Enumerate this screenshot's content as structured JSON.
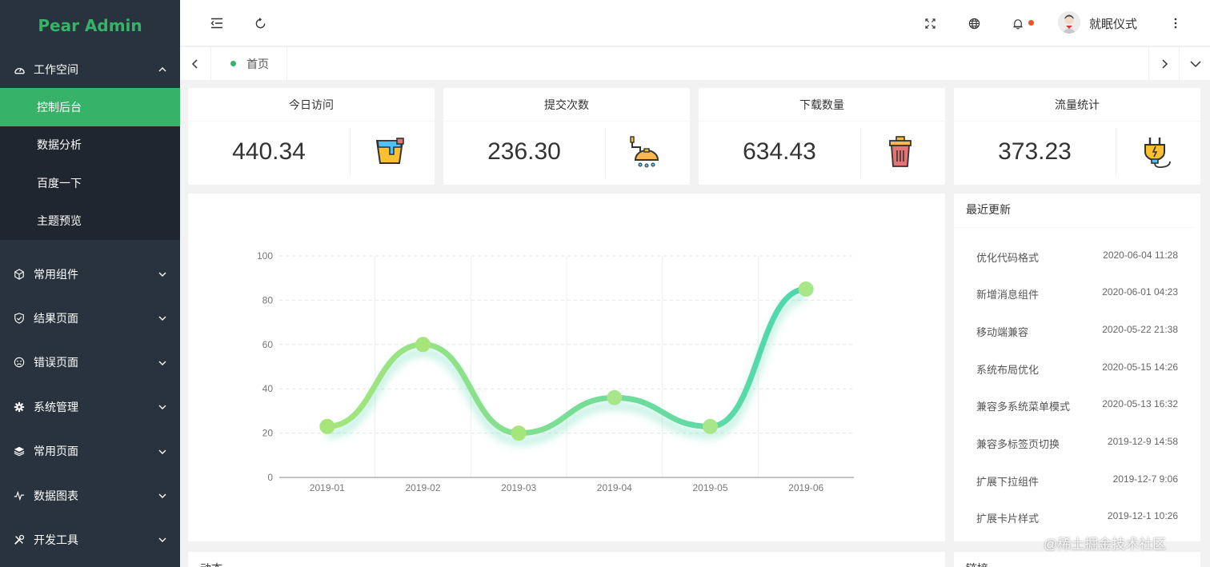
{
  "app": {
    "logo_text": "Pear Admin"
  },
  "sidebar": {
    "groups": [
      {
        "label": "工作空间",
        "icon": "dashboard-icon",
        "expanded": true,
        "items": [
          {
            "label": "控制后台",
            "active": true
          },
          {
            "label": "数据分析"
          },
          {
            "label": "百度一下"
          },
          {
            "label": "主题预览"
          }
        ]
      },
      {
        "label": "常用组件",
        "icon": "cube-icon"
      },
      {
        "label": "结果页面",
        "icon": "shield-check-icon"
      },
      {
        "label": "错误页面",
        "icon": "sad-face-icon"
      },
      {
        "label": "系统管理",
        "icon": "settings-icon"
      },
      {
        "label": "常用页面",
        "icon": "layers-icon"
      },
      {
        "label": "数据图表",
        "icon": "pulse-icon"
      },
      {
        "label": "开发工具",
        "icon": "tools-icon"
      }
    ]
  },
  "header": {
    "username": "就眠仪式",
    "icons": [
      "menu-fold-icon",
      "refresh-icon",
      "fullscreen-icon",
      "globe-icon",
      "bell-icon",
      "more-icon"
    ]
  },
  "tabs": {
    "home_label": "首页"
  },
  "stats": [
    {
      "title": "今日访问",
      "value": "440.34",
      "icon": "paint-bucket-icon"
    },
    {
      "title": "提交次数",
      "value": "236.30",
      "icon": "shower-icon"
    },
    {
      "title": "下载数量",
      "value": "634.43",
      "icon": "trash-bin-icon"
    },
    {
      "title": "流量统计",
      "value": "373.23",
      "icon": "plug-icon"
    }
  ],
  "updates": {
    "title": "最近更新",
    "items": [
      {
        "text": "优化代码格式",
        "time": "2020-06-04 11:28"
      },
      {
        "text": "新增消息组件",
        "time": "2020-06-01 04:23"
      },
      {
        "text": "移动端兼容",
        "time": "2020-05-22 21:38"
      },
      {
        "text": "系统布局优化",
        "time": "2020-05-15 14:26"
      },
      {
        "text": "兼容多系统菜单模式",
        "time": "2020-05-13 16:32"
      },
      {
        "text": "兼容多标签页切换",
        "time": "2019-12-9 14:58"
      },
      {
        "text": "扩展下拉组件",
        "time": "2019-12-7 9:06"
      },
      {
        "text": "扩展卡片样式",
        "time": "2019-12-1 10:26"
      }
    ]
  },
  "bottom": {
    "left_title": "动态",
    "right_title": "链接"
  },
  "watermark": "@稀土掘金技术社区",
  "colors": {
    "accent": "#36b368",
    "sidebar_bg": "#28333e",
    "submenu_bg": "#1f262f",
    "line_start": "#a6e57a",
    "line_end": "#4cd7b0"
  },
  "chart_data": {
    "type": "line",
    "categories": [
      "2019-01",
      "2019-02",
      "2019-03",
      "2019-04",
      "2019-05",
      "2019-06"
    ],
    "series": [
      {
        "values": [
          23,
          60,
          20,
          36,
          23,
          85
        ]
      }
    ],
    "yticks": [
      "0",
      "20",
      "40",
      "60",
      "80",
      "100"
    ],
    "ylim": [
      0,
      100
    ],
    "smooth": true,
    "grid": true
  }
}
